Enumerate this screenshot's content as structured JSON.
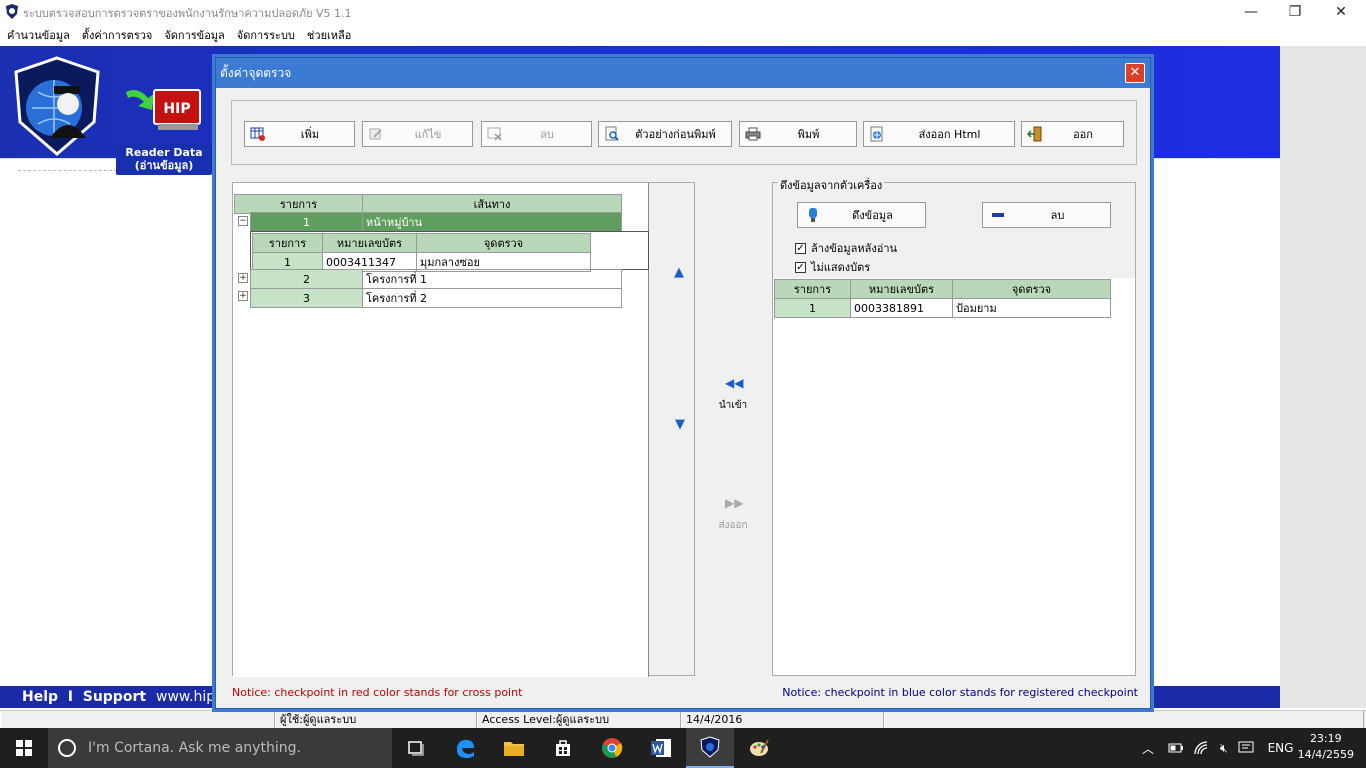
{
  "app": {
    "title": "ระบบตรวจสอบการตรวจตราของพนักงานรักษาความปลอดภัย V5 1.1",
    "menu": [
      "คำนวนข้อมูล",
      "ตั้งค่าการตรวจ",
      "จัดการข้อมูล",
      "จัดการระบบ",
      "ช่วยเหลือ"
    ],
    "badge": "HIP",
    "reader_line1": "Reader Data",
    "reader_line2": "(อ่านข้อมูล)",
    "help_text": "Help  I  Support",
    "www_text": "www.hip"
  },
  "dialog": {
    "title": "ตั้งค่าจุดตรวจ",
    "toolbar": {
      "add": "เพิ่ม",
      "edit": "แก้ไข",
      "delete": "ลบ",
      "preview": "ตัวอย่างก่อนพิมพ์",
      "print": "พิมพ์",
      "export": "ส่งออก Html",
      "exit": "ออก"
    },
    "route_grid": {
      "headers": [
        "รายการ",
        "เส้นทาง"
      ],
      "rows": [
        {
          "no": "1",
          "name": "หน้าหมู่บ้าน",
          "expander": "−"
        },
        {
          "no": "2",
          "name": "โครงการที่ 1",
          "expander": "+"
        },
        {
          "no": "3",
          "name": "โครงการที่ 2",
          "expander": "+"
        }
      ],
      "child_headers": [
        "รายการ",
        "หมายเลขบัตร",
        "จุดตรวจ"
      ],
      "child_rows": [
        {
          "no": "1",
          "card": "0003411347",
          "point": "มุมกลางซอย"
        }
      ]
    },
    "import_label": "นำเข้า",
    "export_label": "ส่งออก",
    "reader": {
      "group_label": "ดึงข้อมูลจากตัวเครื่อง",
      "fetch": "ดึงข้อมูล",
      "delete": "ลบ",
      "check_clear": "ล้างข้อมูลหลังอ่าน",
      "check_hide": "ไม่แสดงบัตร",
      "headers": [
        "รายการ",
        "หมายเลขบัตร",
        "จุดตรวจ"
      ],
      "rows": [
        {
          "no": "1",
          "card": "0003381891",
          "point": "ป้อมยาม"
        }
      ]
    },
    "notice_red": "Notice: checkpoint in red color stands for cross point",
    "notice_blue": "Notice: checkpoint in blue color stands for registered checkpoint"
  },
  "status": {
    "user": "ผู้ใช้:ผู้ดูแลระบบ",
    "access": "Access Level:ผู้ดูแลระบบ",
    "date": "14/4/2016"
  },
  "taskbar": {
    "cortana": "I'm Cortana. Ask me anything.",
    "lang": "ENG",
    "time": "23:19",
    "date": "14/4/2559"
  }
}
